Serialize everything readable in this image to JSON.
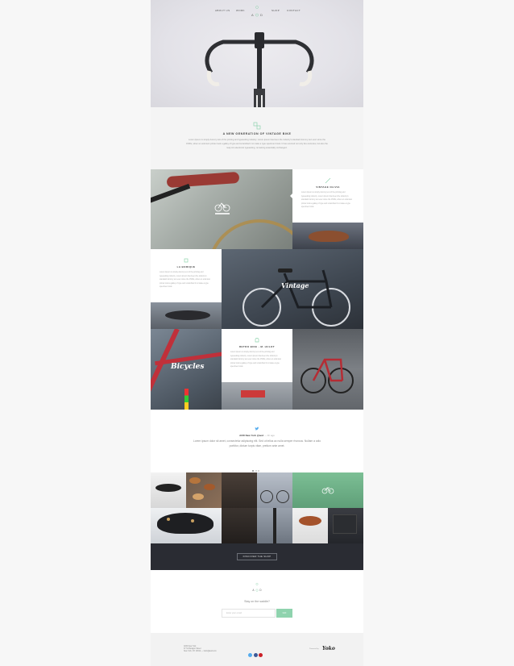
{
  "nav": {
    "items": [
      {
        "label": "ABOUT US"
      },
      {
        "label": "WORK"
      },
      {
        "label": "SHOP"
      },
      {
        "label": "CONTACT"
      }
    ],
    "logo_text": "A O D"
  },
  "intro": {
    "title": "A NEW GENERATION OF VINTAGE BIKE",
    "body": "Lorem Ipsum is simply dummy text of the printing and typesetting industry. Lorem Ipsum has been the industry's standard dummy text ever since the 1500s, when an unknown printer took a galley of type and scrambled it to make a type specimen book. It has survived not only five centuries, but also the leap into electronic typesetting, remaining essentially unchanged."
  },
  "cards": [
    {
      "title": "VINTAGE OLIVIA",
      "body": "Lorem Ipsum is simply dummy text of the printing and typesetting industry. Lorem Ipsum has been the industry's standard dummy text ever since the 1500s, when an unknown printer took a galley of type and scrambled it to make a type specimen book."
    },
    {
      "title": "LA BORIQUE",
      "body": "Lorem Ipsum is simply dummy text of the printing and typesetting industry. Lorem Ipsum has been the industry's standard dummy text ever since the 1500s, when an unknown printer took a galley of type and scrambled it to make a type specimen book."
    },
    {
      "title": "RETRO BIKE - M. HULOT",
      "body": "Lorem Ipsum is simply dummy text of the printing and typesetting industry. Lorem Ipsum has been the industry's standard dummy text ever since the 1500s, when an unknown printer took a galley of type and scrambled it to make a type specimen book."
    }
  ],
  "photo_labels": {
    "vintage": "Vintage",
    "bicycles": "Bicycles"
  },
  "tweet": {
    "author": "AOD New York",
    "handle": "@aod",
    "time": "— 4h ago",
    "text": "Lorem ipsum dolor sit amet, consectetur adipiscing elit. Sed ut tellus ac nulla semper rhoncus. Nullam a odio porttitor, dictum turpis vitae, pretium ante amet."
  },
  "shop": {
    "discover_label": "DISCOVER THE SHOP"
  },
  "newsletter": {
    "question": "Stay on the saddle?",
    "placeholder": "Enter your email",
    "submit_label": "GO"
  },
  "footer": {
    "address_lines": [
      "AOD New York",
      "37 St Paragon Street",
      "New York, NY 10012 — hello@aod.com"
    ],
    "powered_by": "Powered by",
    "brand": "Yoko"
  },
  "colors": {
    "accent": "#8fd3ae",
    "dark": "#2a2c33",
    "twitter": "#55acee",
    "facebook": "#3b5998",
    "pinterest": "#cb2027"
  }
}
